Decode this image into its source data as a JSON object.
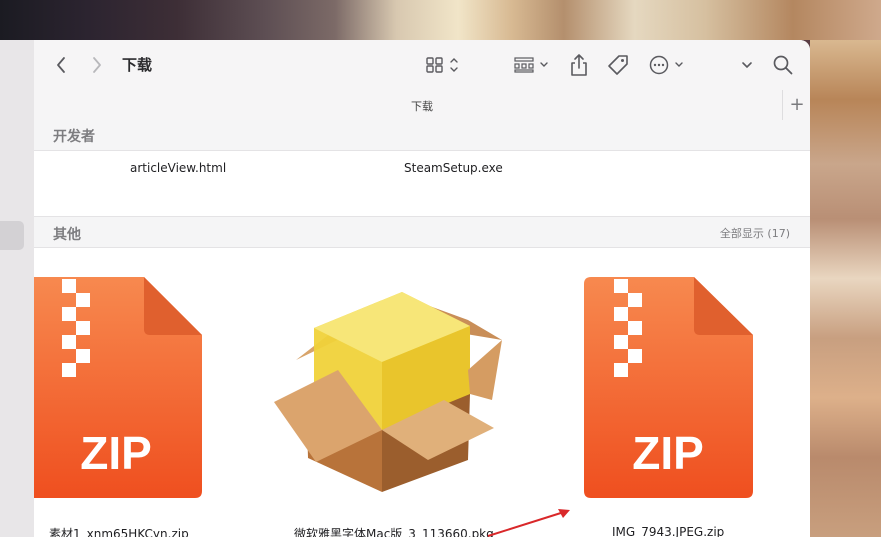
{
  "toolbar": {
    "title": "下载",
    "back_icon": "chevron-left-icon",
    "forward_icon": "chevron-right-icon",
    "view_icon": "grid-view-icon",
    "group_icon": "group-by-icon",
    "share_icon": "share-icon",
    "tag_icon": "tag-icon",
    "more_icon": "ellipsis-circle-icon",
    "search_icon": "search-icon"
  },
  "pathbar": {
    "label": "下载",
    "plus": "+"
  },
  "sections": {
    "developer": {
      "title": "开发者",
      "files": [
        "articleView.html",
        "SteamSetup.exe"
      ]
    },
    "other": {
      "title": "其他",
      "show_all": "全部显示 (17)",
      "files": [
        {
          "name": "素材1_xnm65HKCyn.zip",
          "kind": "zip",
          "badge": "ZIP"
        },
        {
          "name": "微软雅黑字体Mac版_3_113660.pkg",
          "kind": "pkg"
        },
        {
          "name": "IMG_7943.JPEG.zip",
          "kind": "zip",
          "badge": "ZIP"
        }
      ]
    }
  },
  "colors": {
    "zip_orange": "#f26a2e",
    "zip_fold": "#e05a2a",
    "annotation_arrow": "#d9282a"
  }
}
